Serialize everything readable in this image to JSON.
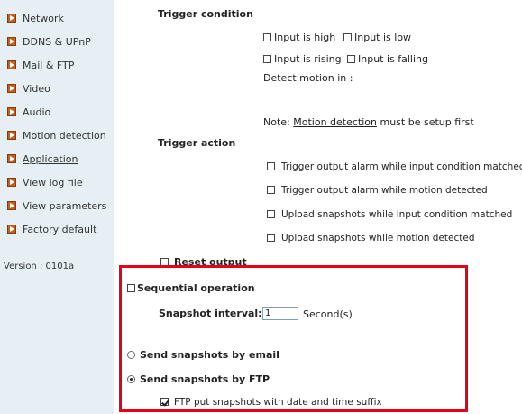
{
  "sidebar": {
    "items": [
      {
        "label": "Network"
      },
      {
        "label": "DDNS & UPnP"
      },
      {
        "label": "Mail & FTP"
      },
      {
        "label": "Video"
      },
      {
        "label": "Audio"
      },
      {
        "label": "Motion detection"
      },
      {
        "label": "Application"
      },
      {
        "label": "View log file"
      },
      {
        "label": "View parameters"
      },
      {
        "label": "Factory default"
      }
    ],
    "version": "Version : 0101a"
  },
  "trigger_condition": {
    "title": "Trigger condition",
    "input_high": "Input is high",
    "input_low": "Input is low",
    "input_rising": "Input is rising",
    "input_falling": "Input is falling",
    "detect_motion": "Detect motion in :",
    "note_prefix": "Note: ",
    "note_link": "Motion detection",
    "note_suffix": " must be setup first"
  },
  "trigger_action": {
    "title": "Trigger action",
    "options": [
      "Trigger output alarm while input condition matched",
      "Trigger output alarm while motion detected",
      "Upload snapshots while input condition matched",
      "Upload snapshots while motion detected"
    ],
    "reset_output": "Reset output"
  },
  "sequential": {
    "label": "Sequential operation",
    "interval_label": "Snapshot interval:",
    "interval_value": "1",
    "unit": "Second(s)"
  },
  "send": {
    "email_label": "Send snapshots by email",
    "ftp_label": "Send snapshots by FTP",
    "ftp_suffix_label": "FTP put snapshots with date and time suffix",
    "selected": "ftp",
    "ftp_suffix_checked": true
  },
  "colors": {
    "highlight": "#e8001a",
    "sidebar_bg": "#e6f0f4",
    "nav_arrow": "#c95f17"
  }
}
